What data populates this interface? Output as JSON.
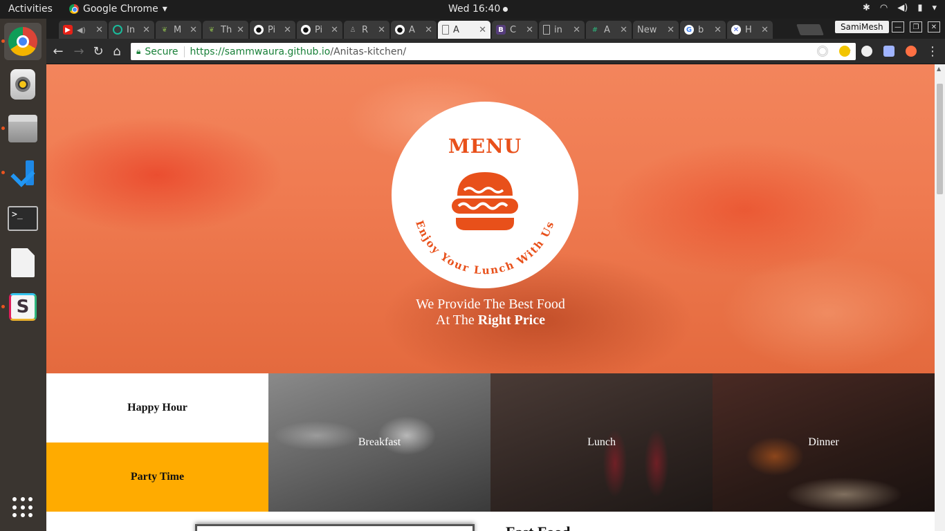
{
  "topbar": {
    "activities": "Activities",
    "app_name": "Google Chrome",
    "clock": "Wed 16:40"
  },
  "dock": {
    "items": [
      "chrome-icon",
      "rhythmbox-icon",
      "files-icon",
      "vscode-icon",
      "terminal-icon",
      "text-editor-icon",
      "slack-icon",
      "show-apps-icon"
    ]
  },
  "tabs": [
    {
      "title": "",
      "favicon": "youtube-icon",
      "color": "#e62117"
    },
    {
      "title": "In",
      "favicon": "ring-icon",
      "color": "#1abc9c"
    },
    {
      "title": "M",
      "favicon": "leaf-icon",
      "color": "#5a7d3a"
    },
    {
      "title": "Th",
      "favicon": "leaf-icon",
      "color": "#5a7d3a"
    },
    {
      "title": "Pi",
      "favicon": "github-icon",
      "color": "#ffffff"
    },
    {
      "title": "Pi",
      "favicon": "github-icon",
      "color": "#ffffff"
    },
    {
      "title": "R",
      "favicon": "person-icon",
      "color": "#888888"
    },
    {
      "title": "A",
      "favicon": "github-icon",
      "color": "#ffffff"
    },
    {
      "title": "A",
      "favicon": "page-icon",
      "color": "#777777"
    },
    {
      "title": "C",
      "favicon": "bootstrap-icon",
      "color": "#563d7c"
    },
    {
      "title": "in",
      "favicon": "page-icon",
      "color": "#bbbbbb"
    },
    {
      "title": "A",
      "favicon": "slack-icon",
      "color": "#2eb67d"
    },
    {
      "title": "New",
      "favicon": "",
      "color": ""
    },
    {
      "title": "b",
      "favicon": "google-icon",
      "color": "#4285f4"
    },
    {
      "title": "H",
      "favicon": "x-icon",
      "color": "#3b5bdb"
    }
  ],
  "profile_name": "SamiMesh",
  "omnibox": {
    "secure_label": "Secure",
    "url_host": "https://sammwaura.github.io",
    "url_path": "/Anitas-kitchen/"
  },
  "colors": {
    "accent_orange": "#e8501a",
    "party_yellow": "#ffab00",
    "secure_green": "#188038"
  },
  "hero": {
    "menu_title": "MENU",
    "arc_text": "Enjoy Your Lunch With Us",
    "tagline_line1": "We Provide The Best Food",
    "tagline_prefix": "At The ",
    "tagline_bold": "Right Price"
  },
  "tiles": {
    "happy_hour": "Happy Hour",
    "party_time": "Party Time",
    "breakfast": "Breakfast",
    "lunch": "Lunch",
    "dinner": "Dinner"
  },
  "below": {
    "heading": "Fast Food"
  }
}
